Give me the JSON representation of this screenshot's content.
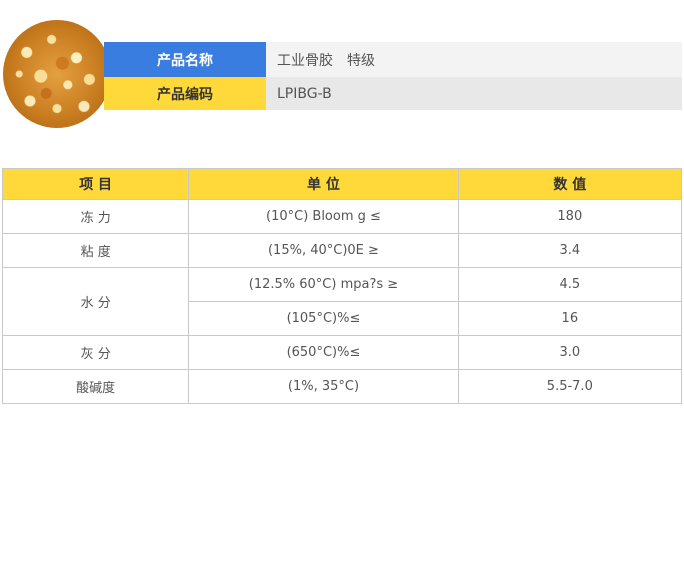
{
  "header": {
    "name_label": "产品名称",
    "name_value": "工业骨胶　特级",
    "code_label": "产品编码",
    "code_value": "LPIBG-B"
  },
  "table": {
    "headers": [
      "项 目",
      "单 位",
      "数 值"
    ],
    "rows": [
      {
        "item": "冻 力",
        "unit": "(10°C) Bloom g ≤",
        "value": "180"
      },
      {
        "item": "粘 度",
        "unit": "(15%, 40°C)0E ≥",
        "value": "3.4"
      },
      {
        "item": "水 分",
        "unit": "(12.5% 60°C) mpa?s ≥",
        "value": "4.5"
      },
      {
        "item": "",
        "unit": "(105°C)%≤",
        "value": "16"
      },
      {
        "item": "灰 分",
        "unit": "(650°C)%≤",
        "value": "3.0"
      },
      {
        "item": "酸碱度",
        "unit": "(1%, 35°C)",
        "value": "5.5-7.0"
      }
    ]
  },
  "colors": {
    "blue_label": "#3a7de0",
    "yellow_label": "#ffd83a",
    "border": "#c9c9c9"
  }
}
